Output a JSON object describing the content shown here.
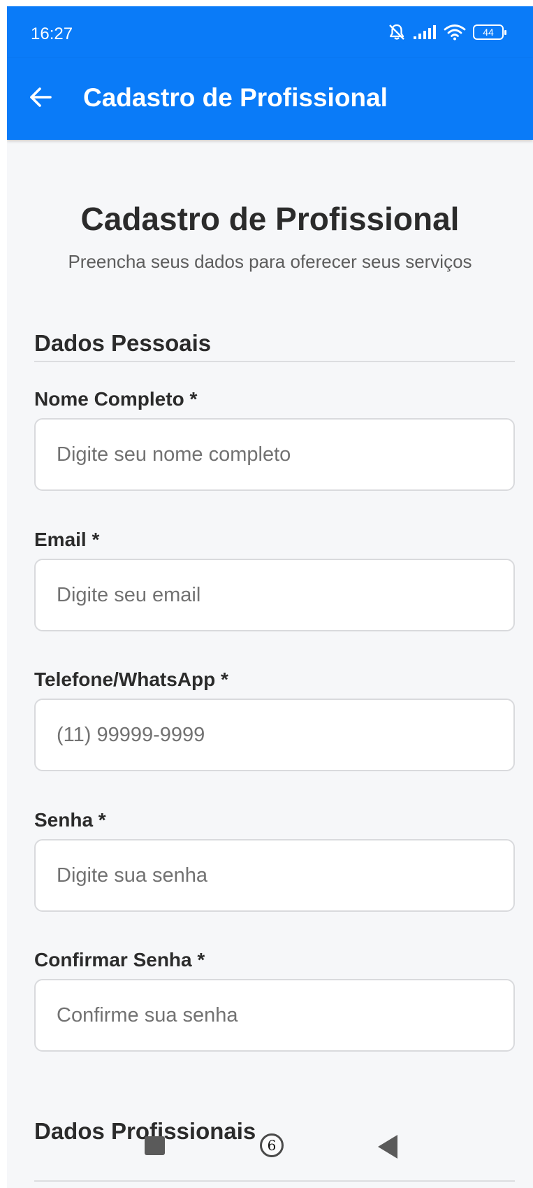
{
  "status_bar": {
    "time": "16:27",
    "battery_level": "44",
    "icons": [
      "bell-off-icon",
      "signal-icon",
      "wifi-icon",
      "battery-icon"
    ]
  },
  "app_bar": {
    "title": "Cadastro de Profissional",
    "back_icon": "arrow-left-icon"
  },
  "header": {
    "title": "Cadastro de Profissional",
    "subtitle": "Preencha seus dados para oferecer seus serviços"
  },
  "sections": {
    "personal": {
      "title": "Dados Pessoais",
      "fields": {
        "name": {
          "label": "Nome Completo *",
          "placeholder": "Digite seu nome completo",
          "value": ""
        },
        "email": {
          "label": "Email *",
          "placeholder": "Digite seu email",
          "value": ""
        },
        "phone": {
          "label": "Telefone/WhatsApp *",
          "placeholder": "(11) 99999-9999",
          "value": ""
        },
        "password": {
          "label": "Senha *",
          "placeholder": "Digite sua senha",
          "value": ""
        },
        "confirm_password": {
          "label": "Confirmar Senha *",
          "placeholder": "Confirme sua senha",
          "value": ""
        }
      }
    },
    "professional": {
      "title": "Dados Profissionais"
    }
  },
  "nav_bar": {
    "recents_badge": "6",
    "icons": [
      "home-button-icon",
      "recents-icon",
      "back-triangle-icon"
    ]
  },
  "colors": {
    "primary": "#0a7bf8",
    "background": "#f6f7f9",
    "text": "#2b2b2b",
    "muted_text": "#5d5d5d",
    "input_border": "#d9dadd"
  }
}
